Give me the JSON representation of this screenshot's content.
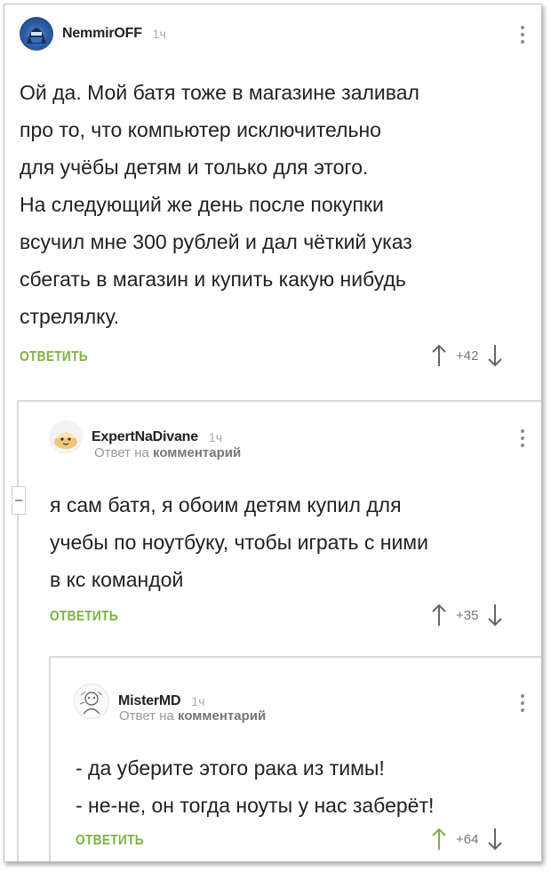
{
  "comments": [
    {
      "author": "NemmirOFF",
      "time": "1ч",
      "body": "Ой да. Мой батя тоже в магазине заливал\nпро то, что компьютер исключительно\nдля учёбы детям и только для этого.\nНа следующий же день после покупки\nвсучил мне 300 рублей и дал чёткий указ\nсбегать в магазин и купить какую нибудь\nстрелялку.",
      "reply_label": "ОТВЕТИТЬ",
      "score": "+42",
      "avatar_icon": "sub-zero-avatar",
      "upvoted": false
    },
    {
      "author": "ExpertNaDivane",
      "time": "1ч",
      "sub_prefix": "Ответ на",
      "sub_link": "комментарий",
      "body": "я сам батя, я обоим детям купил для\nучебы по ноутбуку, чтобы играть с ними\nв кс командой",
      "reply_label": "ОТВЕТИТЬ",
      "score": "+35",
      "avatar_icon": "cake-avatar",
      "upvoted": false
    },
    {
      "author": "MisterMD",
      "time": "1ч",
      "sub_prefix": "Ответ на",
      "sub_link": "комментарий",
      "body": "- да уберите этого рака из тимы!\n- не-не, он тогда ноуты у нас заберёт!",
      "reply_label": "ОТВЕТИТЬ",
      "score": "+64",
      "avatar_icon": "sketch-avatar",
      "upvoted": true
    }
  ],
  "colors": {
    "accent_green": "#7cb342",
    "arrow_gray": "#666666",
    "thread_line": "#d9d9d9"
  }
}
